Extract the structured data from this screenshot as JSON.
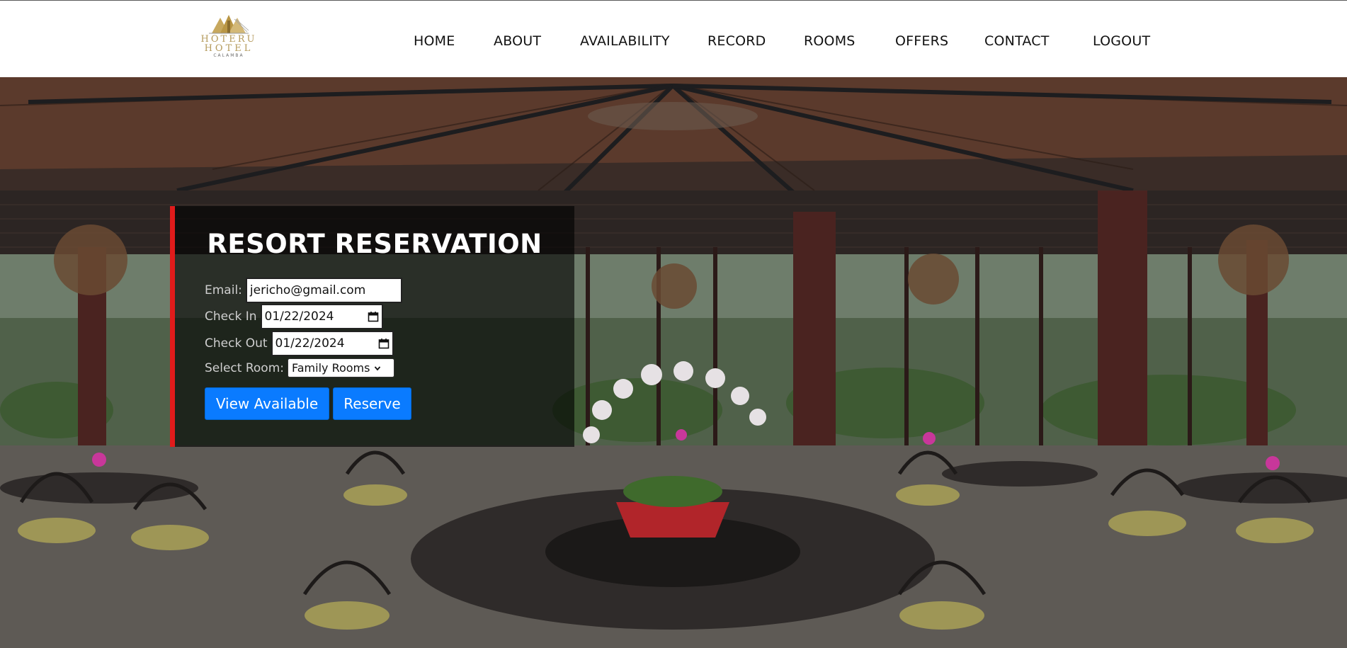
{
  "header": {
    "logo": {
      "line1": "HOTERU",
      "line2": "HOTEL",
      "line3": "CALAMBA"
    },
    "nav": [
      {
        "label": "HOME"
      },
      {
        "label": "ABOUT"
      },
      {
        "label": "AVAILABILITY"
      },
      {
        "label": "RECORD"
      },
      {
        "label": "ROOMS"
      },
      {
        "label": "OFFERS"
      },
      {
        "label": "CONTACT"
      },
      {
        "label": "LOGOUT"
      }
    ]
  },
  "hero": {
    "image_icon": "restaurant-dining-hall-photo"
  },
  "reservation": {
    "title": "RESORT RESERVATION",
    "email_label": "Email:",
    "email_value": "jericho@gmail.com",
    "checkin_label": "Check In",
    "checkin_value": "01/22/2024",
    "checkout_label": "Check Out",
    "checkout_value": "01/22/2024",
    "room_label": "Select Room:",
    "room_value": "Family Rooms",
    "view_button": "View Available",
    "reserve_button": "Reserve",
    "calendar_icon": "calendar-icon",
    "accent_color": "#e01b1b",
    "button_color": "#0a7bff"
  }
}
